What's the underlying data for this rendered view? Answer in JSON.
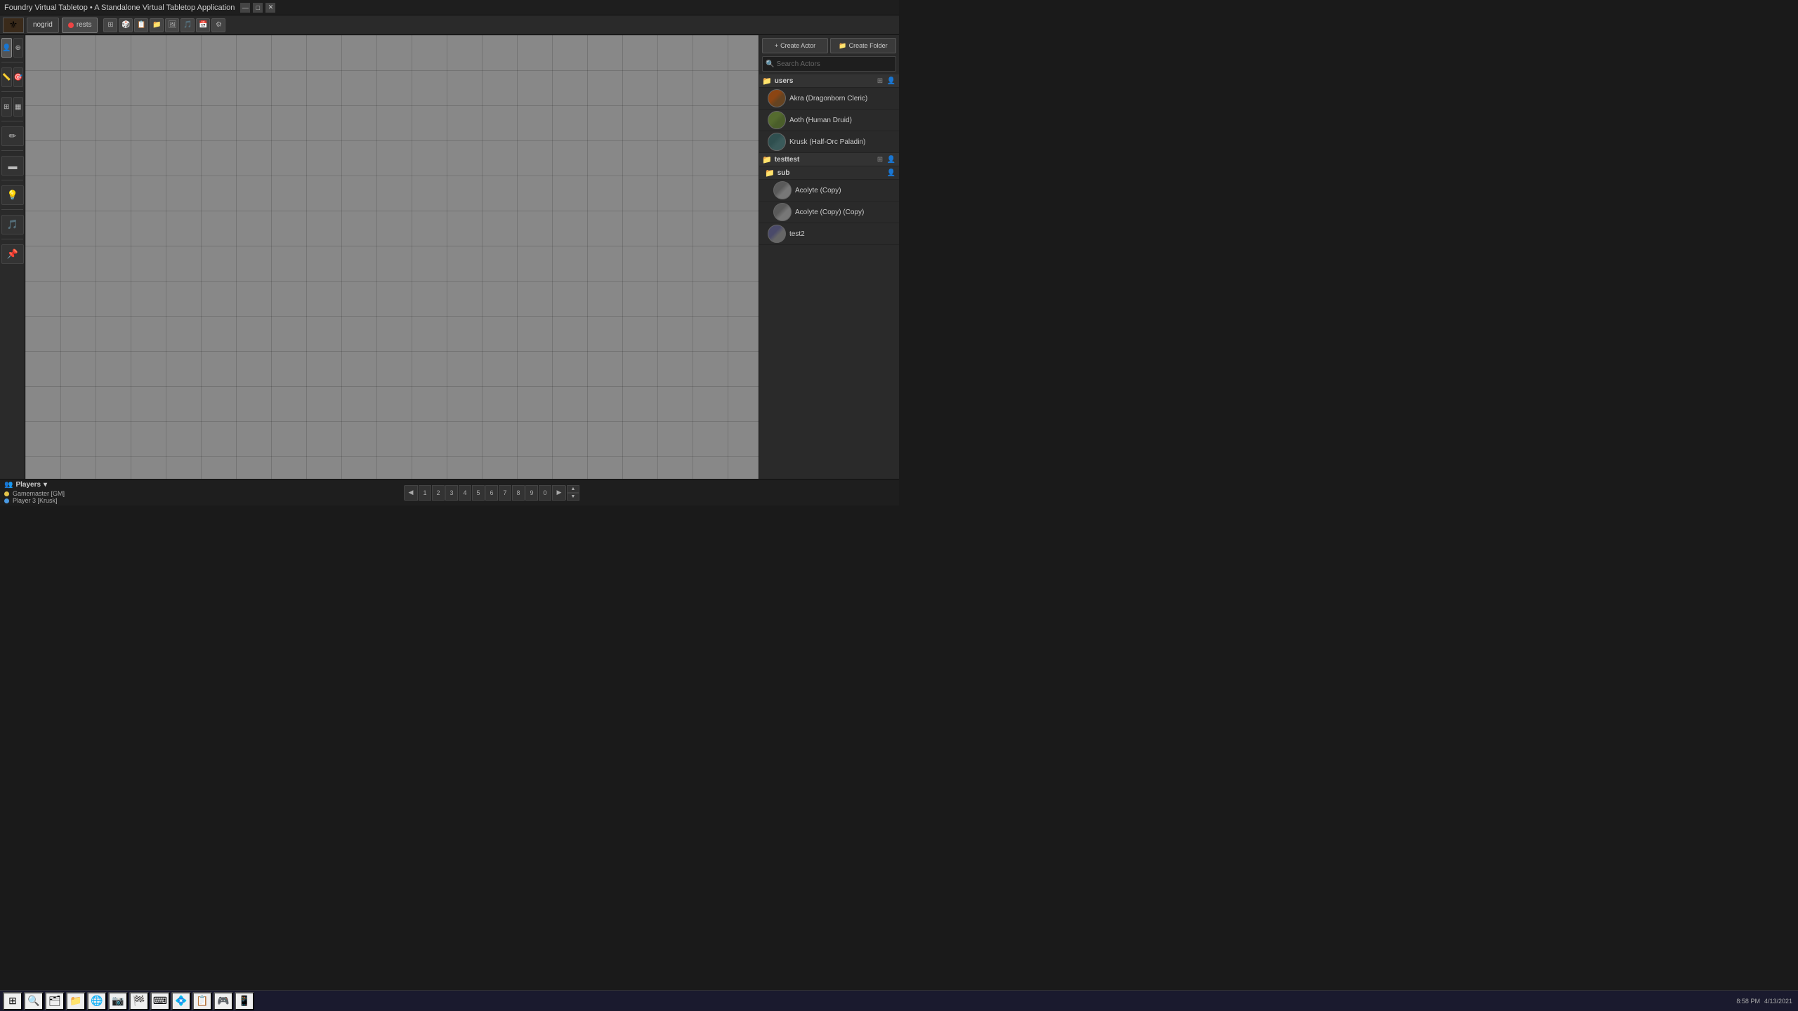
{
  "window": {
    "title": "Foundry Virtual Tabletop • A Standalone Virtual Tabletop Application"
  },
  "titlebar": {
    "minimize": "—",
    "maximize": "□",
    "close": "✕"
  },
  "toolbar": {
    "logo_icon": "⚜",
    "collapse_btn": "‹",
    "scenes": [
      {
        "id": "nogrid",
        "label": "nogrid",
        "active": false
      },
      {
        "id": "rests",
        "label": "rests",
        "active": true,
        "has_dot": true
      }
    ],
    "icons": [
      "⊞",
      "🎲",
      "📋",
      "📁",
      "🖼",
      "🎵",
      "📅",
      "⚙"
    ]
  },
  "left_tools": {
    "groups": [
      {
        "tools": [
          {
            "name": "select",
            "icon": "👤",
            "active": true
          },
          {
            "name": "target",
            "icon": "⊕",
            "active": false
          }
        ]
      },
      {
        "tools": [
          {
            "name": "measure",
            "icon": "📏",
            "active": false
          },
          {
            "name": "compass",
            "icon": "🎯",
            "active": false
          }
        ]
      },
      {
        "tools": [
          {
            "name": "tile",
            "icon": "⊞",
            "active": false
          },
          {
            "name": "grid",
            "icon": "▦",
            "active": false
          }
        ]
      },
      {
        "tools": [
          {
            "name": "draw",
            "icon": "✏",
            "active": false
          }
        ]
      },
      {
        "tools": [
          {
            "name": "wall",
            "icon": "▬",
            "active": false
          }
        ]
      },
      {
        "tools": [
          {
            "name": "light",
            "icon": "💡",
            "active": false
          }
        ]
      },
      {
        "tools": [
          {
            "name": "sound",
            "icon": "🎵",
            "active": false
          }
        ]
      },
      {
        "tools": [
          {
            "name": "note",
            "icon": "📌",
            "active": false
          }
        ]
      }
    ]
  },
  "actors_panel": {
    "create_actor_label": "Create Actor",
    "create_folder_label": "Create Folder",
    "search_placeholder": "Search Actors",
    "folders": [
      {
        "id": "users",
        "label": "users",
        "actors": [
          {
            "id": "akra",
            "name": "Akra (Dragonborn Cleric)",
            "avatar_class": "avatar-akra"
          },
          {
            "id": "aoth",
            "name": "Aoth (Human Druid)",
            "avatar_class": "avatar-aoth"
          },
          {
            "id": "krusk",
            "name": "Krusk (Half-Orc Paladin)",
            "avatar_class": "avatar-krusk"
          }
        ]
      },
      {
        "id": "testtest",
        "label": "testtest",
        "subfolders": [
          {
            "id": "sub",
            "label": "sub",
            "actors": [
              {
                "id": "acolyte-copy",
                "name": "Acolyte (Copy)",
                "avatar_class": "avatar-acolyte"
              },
              {
                "id": "acolyte-copy-copy",
                "name": "Acolyte (Copy) (Copy)",
                "avatar_class": "avatar-acolyte"
              }
            ]
          }
        ],
        "actors": [
          {
            "id": "test2",
            "name": "test2",
            "avatar_class": "avatar-test2"
          }
        ]
      }
    ]
  },
  "players": {
    "label": "Players",
    "chevron": "▾",
    "list": [
      {
        "id": "gm",
        "name": "Gamemaster [GM]",
        "color": "#e4c44a",
        "online": true
      },
      {
        "id": "p3",
        "name": "Player 3 [Krusk]",
        "color": "#4a9ae4",
        "online": true
      }
    ]
  },
  "scene_nav": {
    "prev_icon": "◀",
    "next_icon": "▶",
    "up_icon": "▲",
    "down_icon": "▼",
    "pages": [
      "1",
      "2",
      "3",
      "4",
      "5",
      "6",
      "7",
      "8",
      "9",
      "0"
    ]
  },
  "taskbar": {
    "time": "8:58 PM",
    "date": "4/13/2021",
    "icons": [
      "⊞",
      "🔍",
      "🗂",
      "📁",
      "🌐",
      "📷",
      "🏁",
      "⌨",
      "💠",
      "📋",
      "🎮",
      "📱"
    ]
  }
}
